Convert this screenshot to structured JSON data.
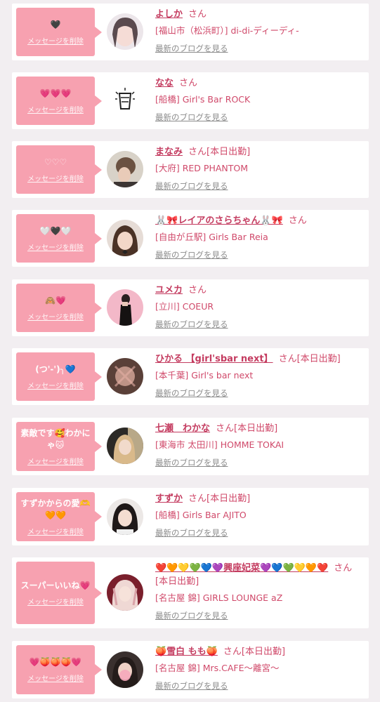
{
  "delete_label": "メッセージを削除",
  "blog_label": "最新のブログを見る",
  "honorific": "さん",
  "colors": {
    "bubble": "#f7a1b0",
    "accent": "#d0496a",
    "link_gray": "#8c8c8c",
    "background": "#f2eef1"
  },
  "entries": [
    {
      "message": "🖤",
      "name": "よしか",
      "working": "",
      "shop": "[福山市（松浜町）] di-di-ディーディ-",
      "avatar": "avatar-photo"
    },
    {
      "message": "💗💗💗",
      "name": "なな",
      "working": "",
      "shop": "[船橋] Girl's Bar ROCK",
      "avatar": "avatar-illustration"
    },
    {
      "message": "♡♡♡",
      "name": "まなみ",
      "working": "[本日出勤]",
      "shop": "[大府] RED PHANTOM",
      "avatar": "avatar-photo"
    },
    {
      "message": "🤍🖤🤍",
      "name": "🐰🎀レイアのさらちゃん🐰🎀",
      "working": "",
      "shop": "[自由が丘駅] Girls Bar Reia",
      "avatar": "avatar-photo"
    },
    {
      "message": "🙈💗",
      "name": "ユメカ",
      "working": "",
      "shop": "[立川] COEUR",
      "avatar": "avatar-photo"
    },
    {
      "message": "(つ'-')╮💙",
      "name": "ひかる 【girl'sbar next】",
      "working": "[本日出勤]",
      "shop": "[本千葉] Girl's bar next",
      "avatar": "avatar-photo"
    },
    {
      "message": "素敵です🥰わかにゃ🐱",
      "name": "七瀬　わかな",
      "working": "[本日出勤]",
      "shop": "[東海市 太田川] HOMME TOKAI",
      "avatar": "avatar-photo"
    },
    {
      "message": "すずかからの愛🫶🧡🧡",
      "name": "すずか",
      "working": "[本日出勤]",
      "shop": "[船橋] Girls Bar AJITO",
      "avatar": "avatar-photo"
    },
    {
      "message": "スーパーいいね💗",
      "name": "❤️🧡💛💚💙💜興座妃菜💜💙💚💛🧡❤️",
      "working": "[本日出勤]",
      "shop": "[名古屋 錦] GIRLS LOUNGE aZ",
      "avatar": "avatar-photo"
    },
    {
      "message": "💗🍑🍑🍑💗",
      "name": "🍑雪白 もも🍑",
      "working": "[本日出勤]",
      "shop": "[名古屋 錦] Mrs.CAFE〜離宮〜",
      "avatar": "avatar-photo"
    }
  ]
}
